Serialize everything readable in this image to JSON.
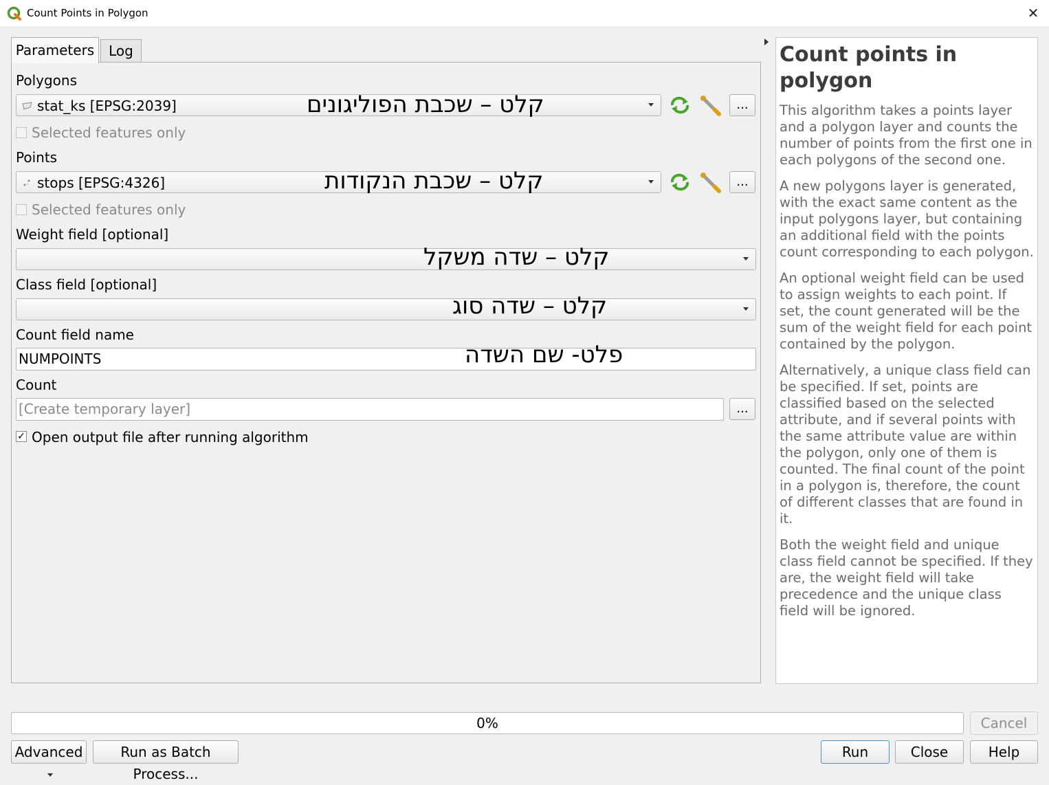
{
  "window": {
    "title": "Count Points in Polygon"
  },
  "tabs": [
    {
      "label": "Parameters"
    },
    {
      "label": "Log"
    }
  ],
  "params": {
    "polygons": {
      "label": "Polygons",
      "value": "stat_ks [EPSG:2039]",
      "annotation": "קלט – שכבת הפוליגונים",
      "selected_only": "Selected features only"
    },
    "points": {
      "label": "Points",
      "value": "stops [EPSG:4326]",
      "annotation": "קלט – שכבת הנקודות",
      "selected_only": "Selected features only"
    },
    "weight": {
      "label": "Weight field [optional]",
      "annotation": "קלט – שדה משקל"
    },
    "class": {
      "label": "Class field [optional]",
      "annotation": "קלט – שדה סוג"
    },
    "count_field": {
      "label": "Count field name",
      "value": "NUMPOINTS",
      "annotation": "פלט- שם השדה"
    },
    "count": {
      "label": "Count",
      "placeholder": "[Create temporary layer]"
    },
    "open_output": {
      "label": "Open output file after running algorithm",
      "checked": true
    },
    "dots_label": "..."
  },
  "help": {
    "title": "Count points in polygon",
    "paragraphs": [
      "This algorithm takes a points layer and a polygon layer and counts the number of points from the first one in each polygons of the second one.",
      "A new polygons layer is generated, with the exact same content as the input polygons layer, but containing an additional field with the points count corresponding to each polygon.",
      "An optional weight field can be used to assign weights to each point. If set, the count generated will be the sum of the weight field for each point contained by the polygon.",
      "Alternatively, a unique class field can be specified. If set, points are classified based on the selected attribute, and if several points with the same attribute value are within the polygon, only one of them is counted. The final count of the point in a polygon is, therefore, the count of different classes that are found in it.",
      "Both the weight field and unique class field cannot be specified. If they are, the weight field will take precedence and the unique class field will be ignored."
    ]
  },
  "footer": {
    "progress": "0%",
    "progress_value": 0,
    "cancel": "Cancel",
    "advanced": "Advanced",
    "batch": "Run as Batch Process...",
    "run": "Run",
    "close": "Close",
    "help": "Help"
  }
}
